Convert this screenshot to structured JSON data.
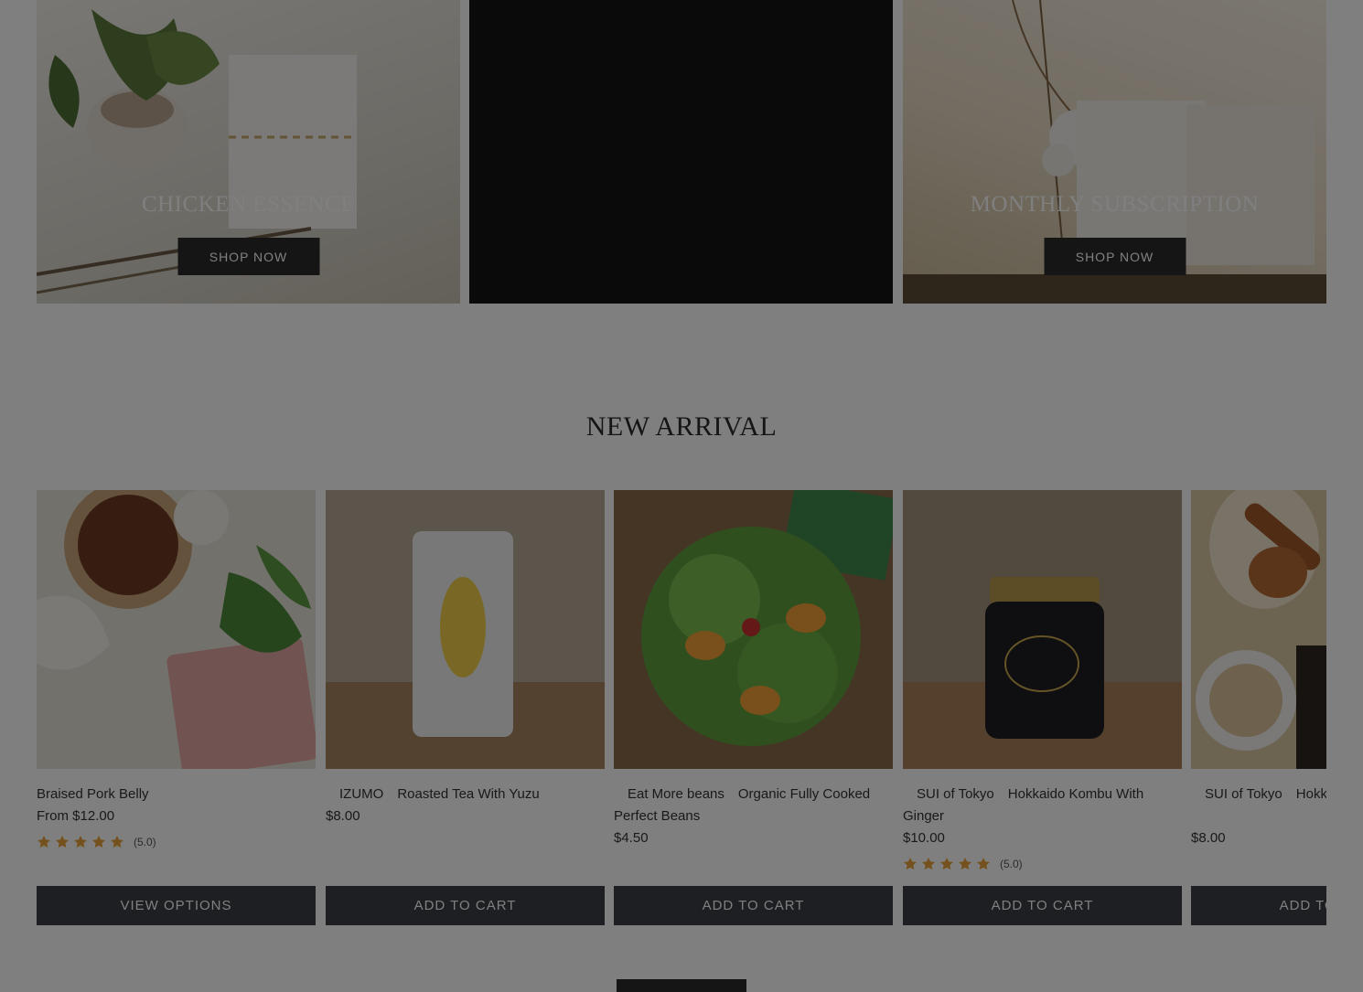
{
  "collections": [
    {
      "title": "Chicken Essence",
      "button": "Shop Now"
    },
    {
      "title": "",
      "button": ""
    },
    {
      "title": "Monthly Subscription",
      "button": "Shop Now"
    }
  ],
  "new_arrival": {
    "title": "NEW ARRIVAL",
    "products": [
      {
        "name": "Braised Pork Belly",
        "price": "From $12.00",
        "rating": 5,
        "rating_text": "(5.0)",
        "button": "View options"
      },
      {
        "name": "　IZUMO　Roasted Tea With Yuzu",
        "price": "$8.00",
        "button": "Add to cart"
      },
      {
        "name": "　Eat More beans　Organic Fully Cooked Perfect Beans",
        "price": "$4.50",
        "button": "Add to cart"
      },
      {
        "name": "　SUI of Tokyo　Hokkaido Kombu With Ginger",
        "price": "$10.00",
        "rating": 5,
        "rating_text": "(5.0)",
        "button": "Add to cart"
      },
      {
        "name": "　SUI of Tokyo　Hokkaido Umami Salt",
        "price": "$8.00",
        "button": "Add to cart"
      }
    ]
  },
  "icons": {
    "star": "star-icon"
  },
  "colors": {
    "star": "#e8a33a",
    "button": "#3a3f44",
    "accent": "#2b2b2b"
  }
}
